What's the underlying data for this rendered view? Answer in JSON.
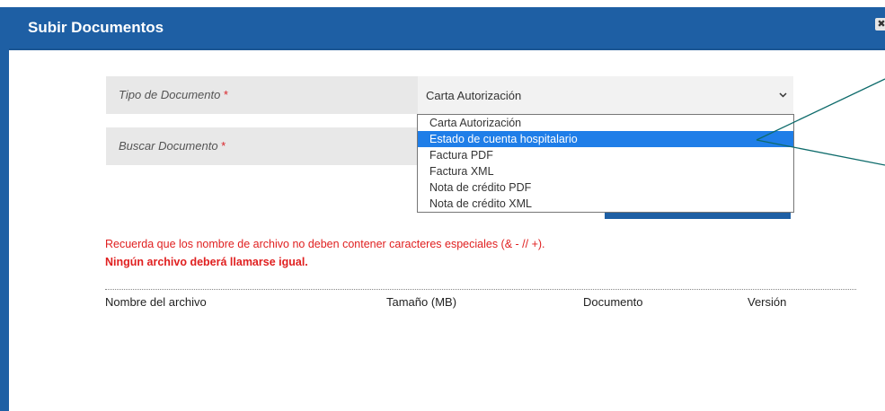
{
  "modal": {
    "title": "Subir Documentos",
    "close_label": "✖"
  },
  "form": {
    "tipo_label": "Tipo de Documento",
    "buscar_label": "Buscar Documento",
    "required_mark": "*",
    "tipo_selected": "Carta Autorización"
  },
  "dropdown": {
    "options": [
      "Carta Autorización",
      "Estado de cuenta hospitalario",
      "Factura PDF",
      "Factura XML",
      "Nota de crédito PDF",
      "Nota de crédito XML"
    ],
    "highlighted": "Estado de cuenta hospitalario"
  },
  "warnings": {
    "line1": "Recuerda que los nombre de archivo no deben contener caracteres especiales (& - // +).",
    "line2": "Ningún archivo deberá llamarse igual."
  },
  "table": {
    "headers": [
      "Nombre del archivo",
      "Tamaño (MB)",
      "Documento",
      "Versión"
    ]
  },
  "colors": {
    "header_bg": "#1e5fa4",
    "highlight": "#1f7ee8",
    "warning": "#e02020",
    "annotation": "#0e6b6b"
  }
}
